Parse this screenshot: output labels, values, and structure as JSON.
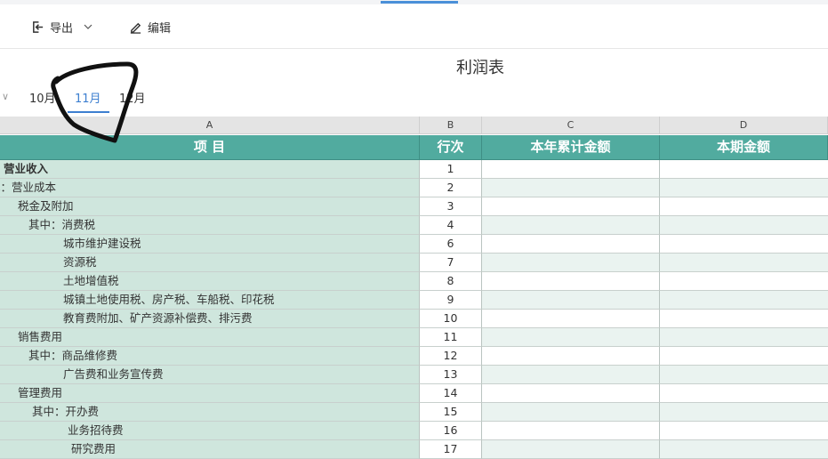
{
  "toolbar": {
    "export_label": "导出",
    "edit_label": "编辑"
  },
  "report": {
    "title": "利润表"
  },
  "month_tabs": [
    {
      "label": "10月"
    },
    {
      "label": "11月"
    },
    {
      "label": "12月"
    }
  ],
  "column_letters": [
    "A",
    "B",
    "C",
    "D"
  ],
  "header": {
    "item": "项  目",
    "line_no": "行次",
    "ytd": "本年累计金额",
    "period": "本期金额"
  },
  "rows": [
    {
      "label": "营业收入",
      "no": "1"
    },
    {
      "label": "减：营业成本",
      "no": "2"
    },
    {
      "label": "税金及附加",
      "no": "3"
    },
    {
      "label": "其中：消费税",
      "no": "4"
    },
    {
      "label": "城市维护建设税",
      "no": "6"
    },
    {
      "label": "资源税",
      "no": "7"
    },
    {
      "label": "土地增值税",
      "no": "8"
    },
    {
      "label": "城镇土地使用税、房产税、车船税、印花税",
      "no": "9"
    },
    {
      "label": "教育费附加、矿产资源补偿费、排污费",
      "no": "10"
    },
    {
      "label": "销售费用",
      "no": "11"
    },
    {
      "label": "其中：商品维修费",
      "no": "12"
    },
    {
      "label": "广告费和业务宣传费",
      "no": "13"
    },
    {
      "label": "管理费用",
      "no": "14"
    },
    {
      "label": "其中：开办费",
      "no": "15"
    },
    {
      "label": "业务招待费",
      "no": "16"
    },
    {
      "label": "研究费用",
      "no": "17"
    }
  ],
  "colors": {
    "header_bg": "#51ab9f",
    "label_bg": "#cfe6dd",
    "active_tab": "#3d7fd0",
    "annotation": "#111111"
  },
  "icons": {
    "export": "export-icon",
    "edit": "edit-pencil-icon",
    "dropdown": "chevron-down-icon"
  }
}
